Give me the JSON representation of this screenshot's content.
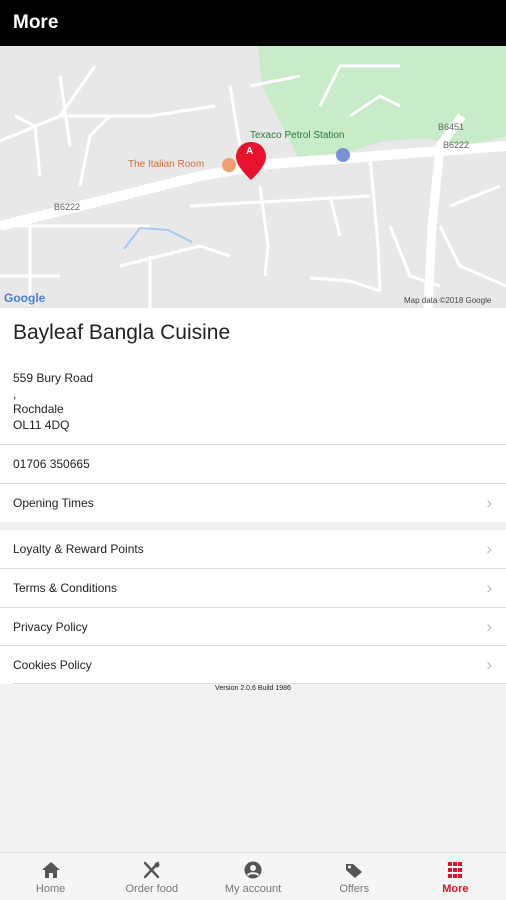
{
  "header": {
    "title": "More"
  },
  "map": {
    "labels": {
      "italian_room": "The Italian Room",
      "petrol_station": "Texaco Petrol Station",
      "google": "Google",
      "map_data": "Map data ©2018 Google",
      "road_b6222_left": "B6222",
      "road_b6222_right": "B6222",
      "road_b6451": "B6451",
      "pin": "A"
    }
  },
  "restaurant": {
    "name": "Bayleaf Bangla Cuisine",
    "address_lines": [
      "559 Bury Road",
      ",",
      "Rochdale",
      "OL11 4DQ"
    ],
    "phone": "01706 350665",
    "opening_times_label": "Opening Times"
  },
  "menu": {
    "loyalty": "Loyalty & Reward Points",
    "terms": "Terms & Conditions",
    "privacy": "Privacy Policy",
    "cookies": "Cookies Policy"
  },
  "version": "Version 2.0.6 Build 1986",
  "colors": {
    "accent": "#e0122d",
    "header_bg": "#000000",
    "park": "#c8ecc7"
  },
  "tabs": [
    {
      "label": "Home",
      "icon": "home-icon",
      "active": false
    },
    {
      "label": "Order food",
      "icon": "cutlery-icon",
      "active": false
    },
    {
      "label": "My account",
      "icon": "account-icon",
      "active": false
    },
    {
      "label": "Offers",
      "icon": "tag-icon",
      "active": false
    },
    {
      "label": "More",
      "icon": "grid-icon",
      "active": true
    }
  ]
}
